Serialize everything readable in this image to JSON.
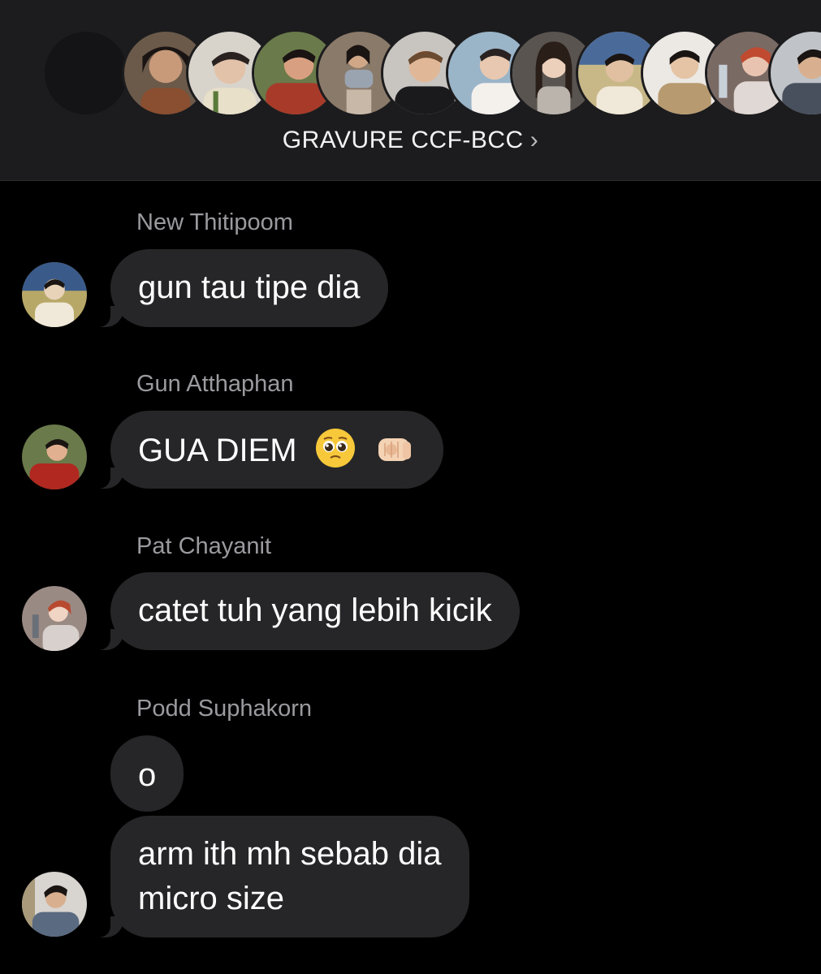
{
  "header": {
    "group_name": "GRAVURE CCF-BCC",
    "chevron_icon": "chevron-right-icon",
    "avatars": [
      {
        "name": "placeholder-avatar",
        "bg": "#141416",
        "fg": "#141416"
      },
      {
        "name": "member-avatar",
        "bg": "#6b5a4a",
        "fg": "#c89a7a"
      },
      {
        "name": "member-avatar",
        "bg": "#d8d4cc",
        "fg": "#e2c2a8"
      },
      {
        "name": "member-avatar",
        "bg": "#a83a2a",
        "fg": "#d8a080"
      },
      {
        "name": "member-avatar",
        "bg": "#8a7a6a",
        "fg": "#d0a888"
      },
      {
        "name": "member-avatar",
        "bg": "#3a3a3a",
        "fg": "#e0b898"
      },
      {
        "name": "member-avatar",
        "bg": "#9ab4c8",
        "fg": "#e8c8b0"
      },
      {
        "name": "member-avatar",
        "bg": "#5a5450",
        "fg": "#ecd0bc"
      },
      {
        "name": "member-avatar",
        "bg": "#c8b888",
        "fg": "#e0c0a0"
      },
      {
        "name": "member-avatar",
        "bg": "#b89a70",
        "fg": "#e4c4a4"
      },
      {
        "name": "member-avatar",
        "bg": "#7a6a64",
        "fg": "#e8c4b0"
      },
      {
        "name": "member-avatar",
        "bg": "#48505e",
        "fg": "#d8b090"
      }
    ]
  },
  "messages": [
    {
      "sender": "New Thitipoom",
      "bubbles": [
        "gun tau tipe dia"
      ],
      "avatar": {
        "bg": "#b8a868",
        "fg": "#e8d2b8",
        "shirt": "#f0e8d8"
      }
    },
    {
      "sender": "Gun Atthaphan",
      "bubbles": [
        "GUA DIEM"
      ],
      "emojis": [
        "pleading-face-emoji",
        "pointing-fist-emoji"
      ],
      "avatar": {
        "bg": "#c84030",
        "fg": "#e0b090",
        "shirt": "#b02820"
      }
    },
    {
      "sender": "Pat Chayanit",
      "bubbles": [
        "catet tuh yang lebih kicik"
      ],
      "avatar": {
        "bg": "#9a8a84",
        "fg": "#f0d4c4",
        "shirt": "#d8d0cc"
      }
    },
    {
      "sender": "Podd Suphakorn",
      "bubbles": [
        "o",
        "arm ith mh sebab dia",
        "micro size"
      ],
      "avatar": {
        "bg": "#d8d4d0",
        "fg": "#d8b090",
        "shirt": "#5a6a80"
      }
    }
  ],
  "colors": {
    "header_bg": "#1c1c1e",
    "bubble_bg": "#262628",
    "sender_text": "#9a9a9f",
    "body_bg": "#000000"
  }
}
